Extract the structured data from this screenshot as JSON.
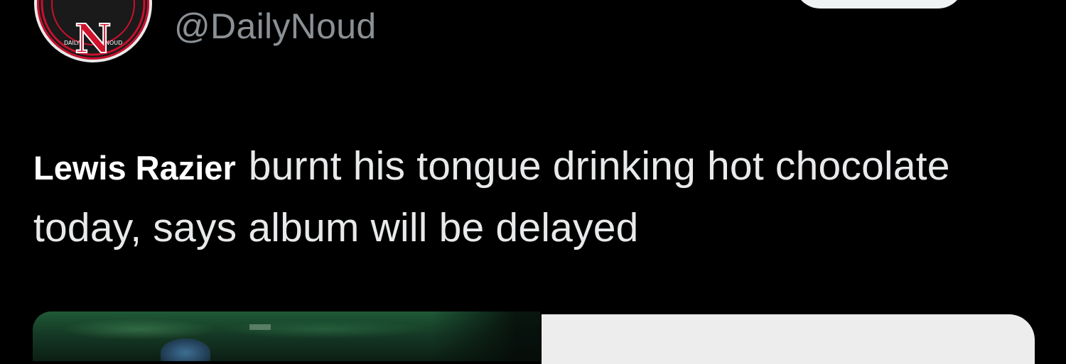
{
  "tweet": {
    "handle": "@DailyNoud",
    "mention": "Lewis Razier",
    "body": "burnt his tongue drinking hot chocolate today, says album will be delayed"
  },
  "avatar": {
    "logo_letter": "N",
    "ring_text_left": "DAILY",
    "ring_text_right": "NOUD"
  },
  "colors": {
    "background": "#000000",
    "text": "#e7e9ea",
    "handle": "#8b9095",
    "logo_red": "#c8102e"
  }
}
